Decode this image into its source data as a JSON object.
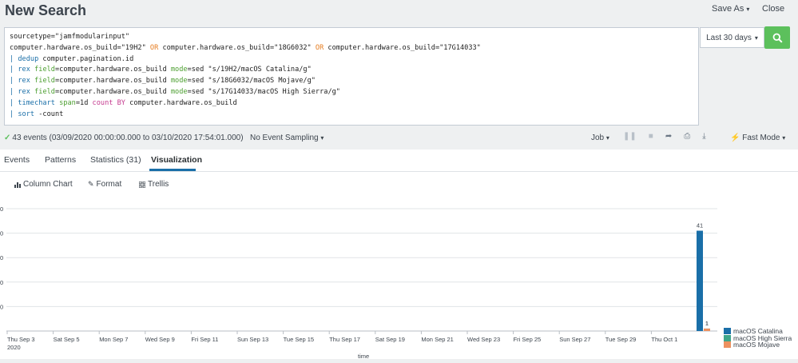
{
  "header": {
    "title": "New Search",
    "save_as": "Save As",
    "close": "Close"
  },
  "search": {
    "lines": [
      "sourcetype=\"jamfmodularinput\"",
      "computer.hardware.os_build=\"19H2\" OR computer.hardware.os_build=\"18G6032\" OR computer.hardware.os_build=\"17G14033\"",
      "| dedup computer.pagination.id",
      "| rex field=computer.hardware.os_build mode=sed \"s/19H2/macOS Catalina/g\"",
      "| rex field=computer.hardware.os_build mode=sed \"s/18G6032/macOS Mojave/g\"",
      "| rex field=computer.hardware.os_build mode=sed \"s/17G14033/macOS High Sierra/g\"",
      "| timechart span=1d count BY computer.hardware.os_build",
      "| sort -count"
    ],
    "time_range": "Last 30 days",
    "search_icon": "search-icon"
  },
  "status": {
    "events": "43 events (03/09/2020 00:00:00.000 to 03/10/2020 17:54:01.000)",
    "sampling": "No Event Sampling",
    "job": "Job",
    "fast_mode": "Fast Mode",
    "job_icons": [
      "pause-icon",
      "stop-icon",
      "share-icon",
      "print-icon",
      "export-icon"
    ]
  },
  "tabs": [
    {
      "label": "Events",
      "active": false
    },
    {
      "label": "Patterns",
      "active": false
    },
    {
      "label": "Statistics (31)",
      "active": false
    },
    {
      "label": "Visualization",
      "active": true
    }
  ],
  "vis_tools": {
    "chart_type": "Column Chart",
    "format": "Format",
    "trellis": "Trellis"
  },
  "chart_data": {
    "type": "bar",
    "stacked": false,
    "xlabel": "time",
    "ylabel": "",
    "ytick_labels": [
      "0",
      "0",
      "0",
      "0",
      "0"
    ],
    "ytick_values": [
      10,
      20,
      30,
      40,
      50
    ],
    "ylim": [
      0,
      50
    ],
    "grid": true,
    "legend_position": "right",
    "x_tick_labels": [
      "Thu Sep 3",
      "Sat Sep 5",
      "Mon Sep 7",
      "Wed Sep 9",
      "Fri Sep 11",
      "Sun Sep 13",
      "Tue Sep 15",
      "Thu Sep 17",
      "Sat Sep 19",
      "Mon Sep 21",
      "Wed Sep 23",
      "Fri Sep 25",
      "Sun Sep 27",
      "Tue Sep 29",
      "Thu Oct 1"
    ],
    "x_tick_sublabel": "2020",
    "series": [
      {
        "name": "macOS Catalina",
        "color": "#1a6fa8",
        "values": [
          41,
          1
        ]
      },
      {
        "name": "macOS High Sierra",
        "color": "#3ea68a",
        "values": [
          0,
          0
        ]
      },
      {
        "name": "macOS Mojave",
        "color": "#ec9160",
        "values": [
          0,
          1
        ]
      }
    ],
    "bar_labels": [
      "41",
      "1",
      "1"
    ]
  }
}
